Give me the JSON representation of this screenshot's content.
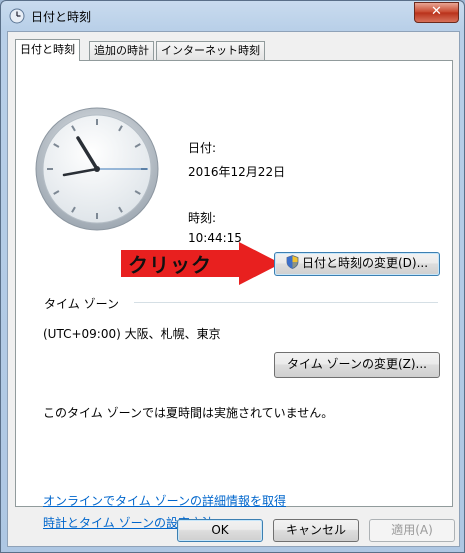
{
  "window": {
    "title": "日付と時刻",
    "close_label": "✕"
  },
  "tabs": [
    "日付と時刻",
    "追加の時計",
    "インターネット時刻"
  ],
  "date": {
    "label": "日付:",
    "value": "2016年12月22日"
  },
  "time": {
    "label": "時刻:",
    "value": "10:44:15"
  },
  "change_datetime_button": "日付と時刻の変更(D)...",
  "annotation": "クリック",
  "timezone": {
    "section_label": "タイム ゾーン",
    "value": "(UTC+09:00) 大阪、札幌、東京",
    "change_button": "タイム ゾーンの変更(Z)...",
    "dst_note": "このタイム ゾーンでは夏時間は実施されていません。"
  },
  "links": [
    "オンラインでタイム ゾーンの詳細情報を取得",
    "時計とタイム ゾーンの設定方法"
  ],
  "dialog_buttons": {
    "ok": "OK",
    "cancel": "キャンセル",
    "apply": "適用(A)"
  },
  "colors": {
    "arrow": "#e8201f",
    "link": "#0066cc",
    "title_close": "#c7452b"
  },
  "icons": {
    "title": "clock-app-icon",
    "button": "uac-shield-icon"
  }
}
